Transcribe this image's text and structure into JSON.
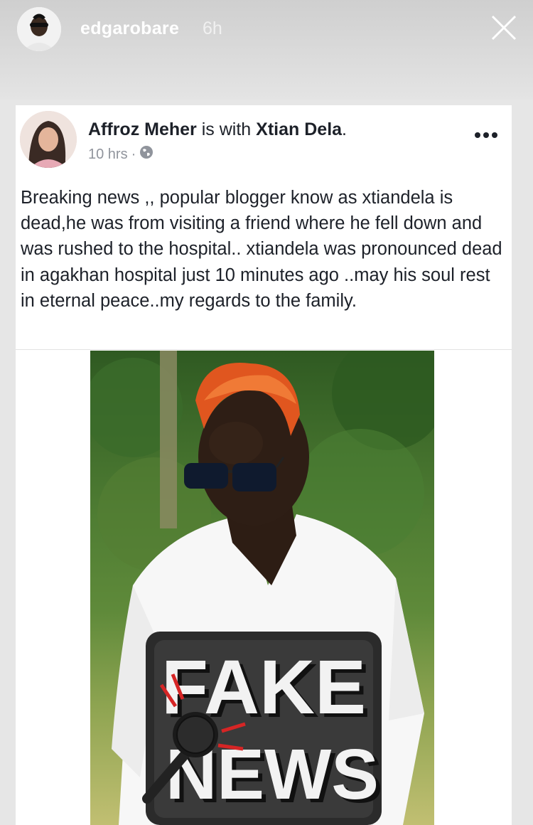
{
  "story": {
    "username": "edgarobare",
    "time": "6h"
  },
  "post": {
    "author": "Affroz Meher",
    "with_text": "is with",
    "tagged": "Xtian Dela",
    "time": "10 hrs",
    "separator": "·",
    "privacy_icon": "globe-icon",
    "more_icon": "more-icon",
    "text": "Breaking news ,, popular blogger know as xtiandela is dead,he was from visiting a friend where he fell down and was rushed to the hospital.. xtiandela was pronounced dead in agakhan hospital just 10 minutes ago ..may his soul rest in eternal peace..my regards to the family.",
    "image_sign_line1": "FAKE",
    "image_sign_line2": "NEWS"
  },
  "colors": {
    "hair": "#e0561f",
    "foliage": "#3f6b2a",
    "sign_bg": "#2b2b2b"
  }
}
